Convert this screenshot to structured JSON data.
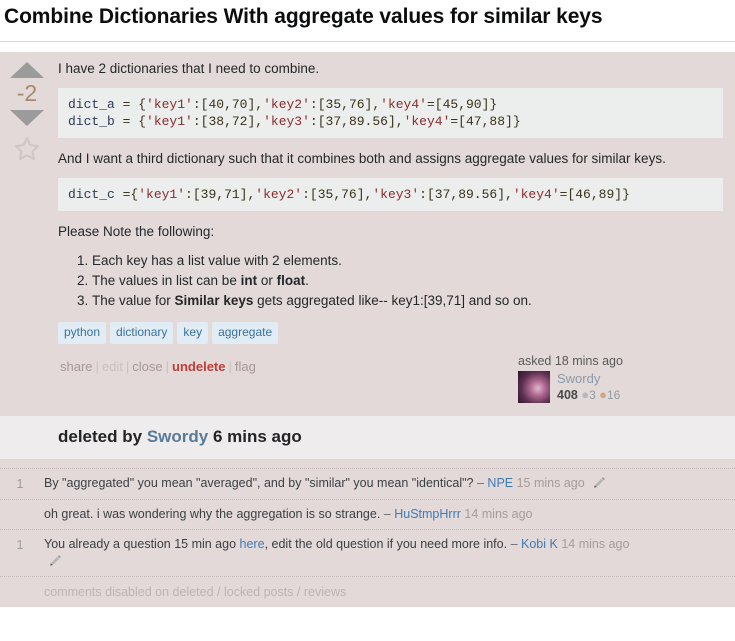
{
  "question": {
    "title": "Combine Dictionaries With aggregate values for similar keys",
    "vote_score": "-2",
    "icons": {
      "vote_up": "triangle-up-icon",
      "vote_down": "triangle-down-icon",
      "favorite": "star-icon"
    },
    "body": {
      "para_1": "I have 2 dictionaries that I need to combine.",
      "code_1_line_1": "dict_a = {'key1':[40,70],'key2':[35,76],'key4'=[45,90]}",
      "code_1_line_2": "dict_b = {'key1':[38,72],'key3':[37,89.56],'key4'=[47,88]}",
      "para_2": "And I want a third dictionary such that it combines both and assigns aggregate values for similar keys.",
      "code_2_line_1": "dict_c ={'key1':[39,71],'key2':[35,76],'key3':[37,89.56],'key4'=[46,89]}",
      "para_3": "Please Note the following:",
      "notes": [
        {
          "pre": "Each key has a list value with 2 elements.",
          "bold": "",
          "post": ""
        },
        {
          "pre": "The values in list can be ",
          "bold": "int",
          "mid": " or ",
          "bold2": "float",
          "post": "."
        },
        {
          "pre": "The value for ",
          "bold": "Similar keys",
          "post": " gets aggregated like-- key1:[39,71] and so on."
        }
      ]
    },
    "tags": [
      "python",
      "dictionary",
      "key",
      "aggregate"
    ],
    "actions": {
      "share": "share",
      "edit": "edit",
      "close": "close",
      "undelete": "undelete",
      "flag": "flag",
      "separator": "|"
    },
    "owner": {
      "asked_label": "asked 18 mins ago",
      "name": "Swordy",
      "reputation": "408",
      "silver_badges": "3",
      "bronze_badges": "16",
      "silver_dot": "●",
      "bronze_dot": "●"
    }
  },
  "deleted_notice": {
    "prefix": "deleted by",
    "user": "Swordy",
    "when": "6 mins ago"
  },
  "comments": [
    {
      "score": "1",
      "text": "By \"aggregated\" you mean \"averaged\", and by \"similar\" you mean \"identical\"?",
      "dash": "–",
      "user": "NPE",
      "date": "15 mins ago",
      "has_edit_icon": true,
      "link_text": "",
      "text_after_link": ""
    },
    {
      "score": "",
      "text": "oh great. i was wondering why the aggregation is so strange.",
      "dash": "–",
      "user": "HuStmpHrrr",
      "date": "14 mins ago",
      "has_edit_icon": false,
      "link_text": "",
      "text_after_link": ""
    },
    {
      "score": "1",
      "text": "You already a question 15 min ago",
      "link_text": "here",
      "text_after_link": ", edit the old question if you need more info.",
      "dash": "–",
      "user": "Kobi K",
      "date": "14 mins ago",
      "has_edit_icon": true
    }
  ],
  "footer": {
    "comments_disabled": "comments disabled on deleted / locked posts / reviews"
  },
  "colors": {
    "deleted_post_bg": "#e3d9d9",
    "code_bg": "#eceded",
    "tag_bg": "#e1ecf4",
    "tag_fg": "#39739d",
    "undelete_red": "#c23c36",
    "link_blue": "#3e7bb6",
    "banner_bg": "#eeecec"
  }
}
